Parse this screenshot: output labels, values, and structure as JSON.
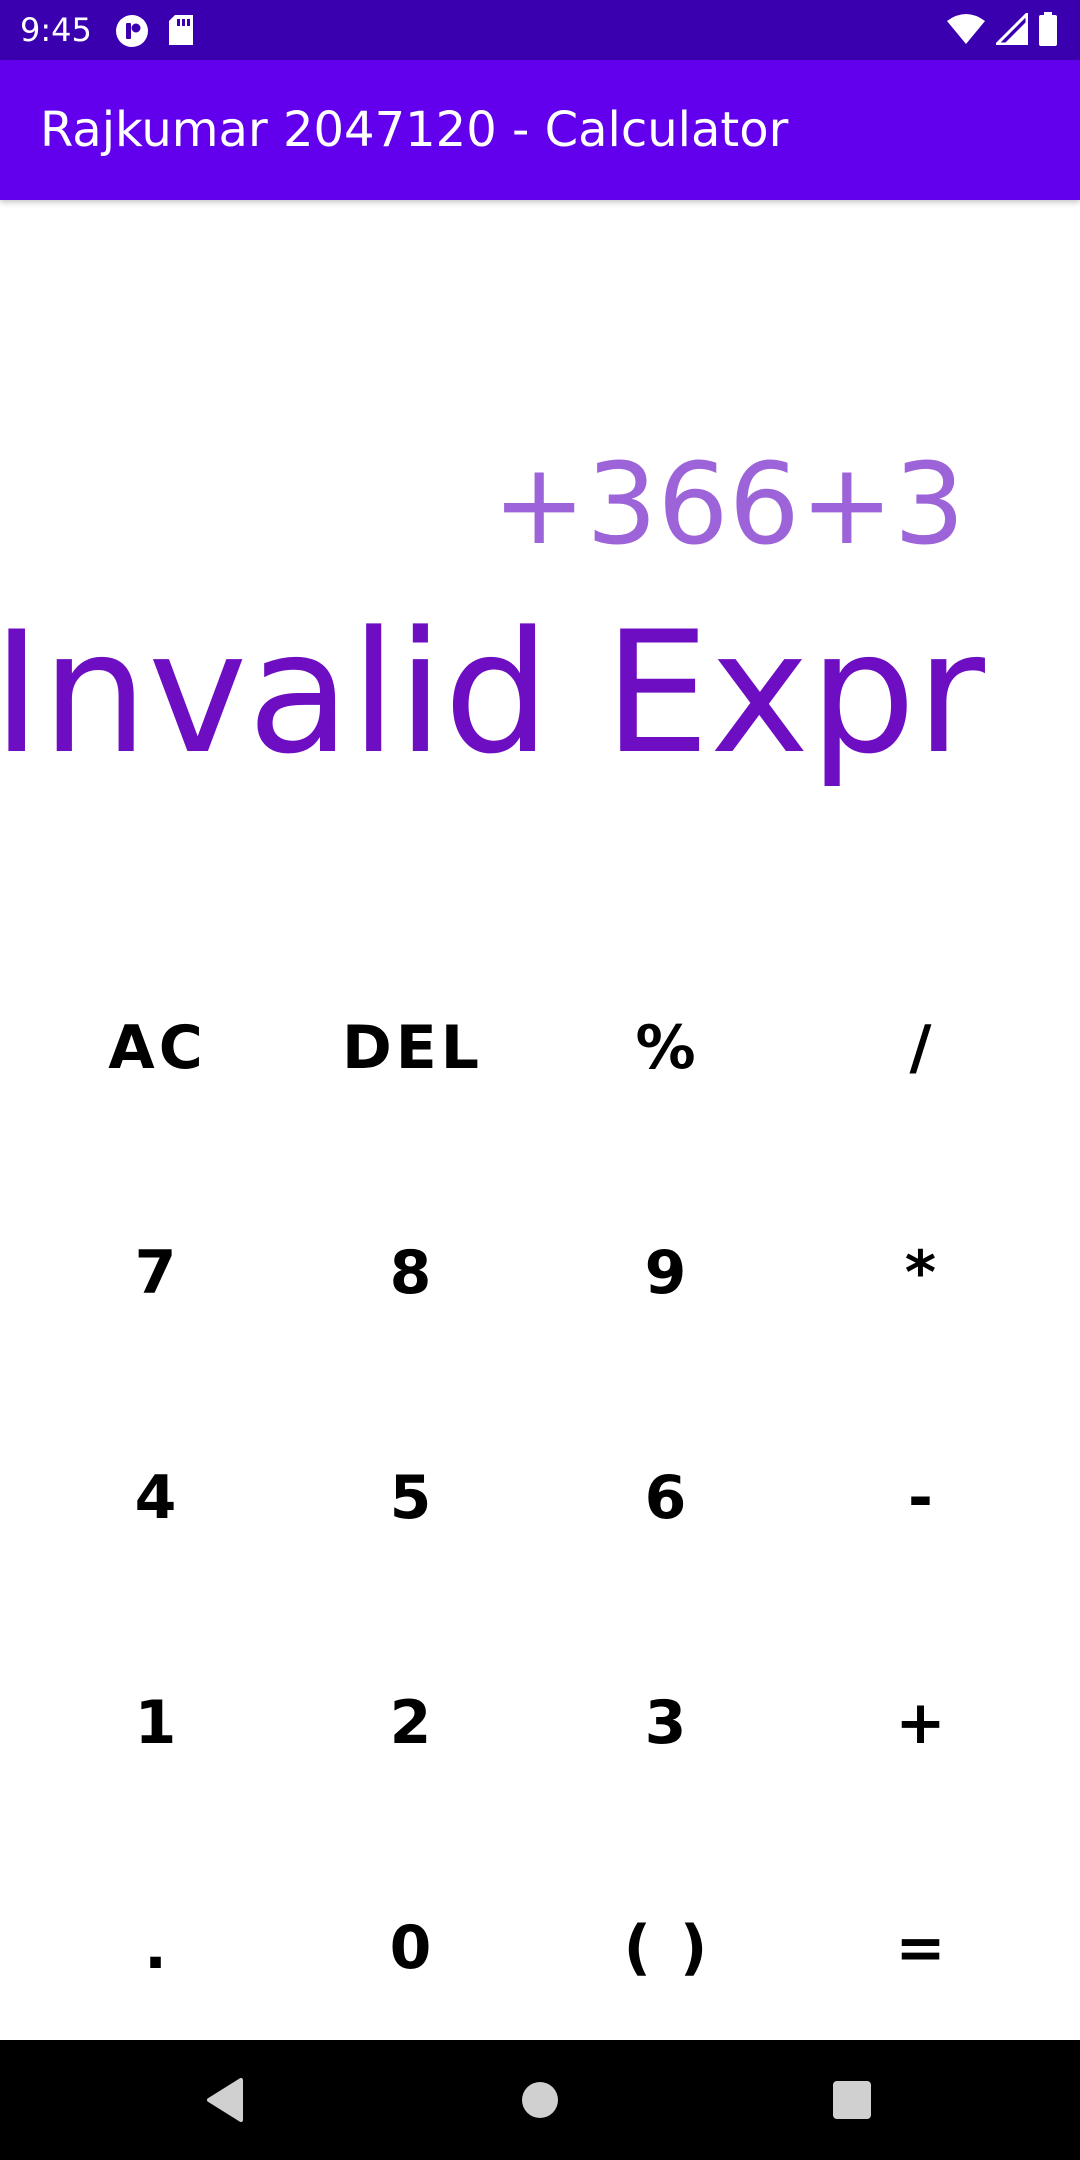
{
  "status_bar": {
    "time": "9:45",
    "icons": [
      "app-notification-icon",
      "sd-card-icon",
      "wifi-icon",
      "cell-signal-icon",
      "battery-icon"
    ]
  },
  "app_bar": {
    "title": "Rajkumar 2047120 - Calculator",
    "color": "#6200ee"
  },
  "display": {
    "expression": "+366+3",
    "result": "Invalid Expr",
    "expression_color": "#9c64d8",
    "result_color": "#6e0ec2"
  },
  "keypad": {
    "keys": [
      {
        "label": "AC",
        "name": "clear-all-button"
      },
      {
        "label": "DEL",
        "name": "delete-button"
      },
      {
        "label": "%",
        "name": "percent-button"
      },
      {
        "label": "/",
        "name": "divide-button"
      },
      {
        "label": "7",
        "name": "digit-7-button"
      },
      {
        "label": "8",
        "name": "digit-8-button"
      },
      {
        "label": "9",
        "name": "digit-9-button"
      },
      {
        "label": "*",
        "name": "multiply-button"
      },
      {
        "label": "4",
        "name": "digit-4-button"
      },
      {
        "label": "5",
        "name": "digit-5-button"
      },
      {
        "label": "6",
        "name": "digit-6-button"
      },
      {
        "label": "-",
        "name": "subtract-button"
      },
      {
        "label": "1",
        "name": "digit-1-button"
      },
      {
        "label": "2",
        "name": "digit-2-button"
      },
      {
        "label": "3",
        "name": "digit-3-button"
      },
      {
        "label": "+",
        "name": "add-button"
      },
      {
        "label": ".",
        "name": "decimal-point-button"
      },
      {
        "label": "0",
        "name": "digit-0-button"
      },
      {
        "label": "( )",
        "name": "parentheses-button"
      },
      {
        "label": "=",
        "name": "equals-button"
      }
    ]
  },
  "nav_bar": {
    "icons": [
      "back-icon",
      "home-icon",
      "recents-icon"
    ]
  }
}
